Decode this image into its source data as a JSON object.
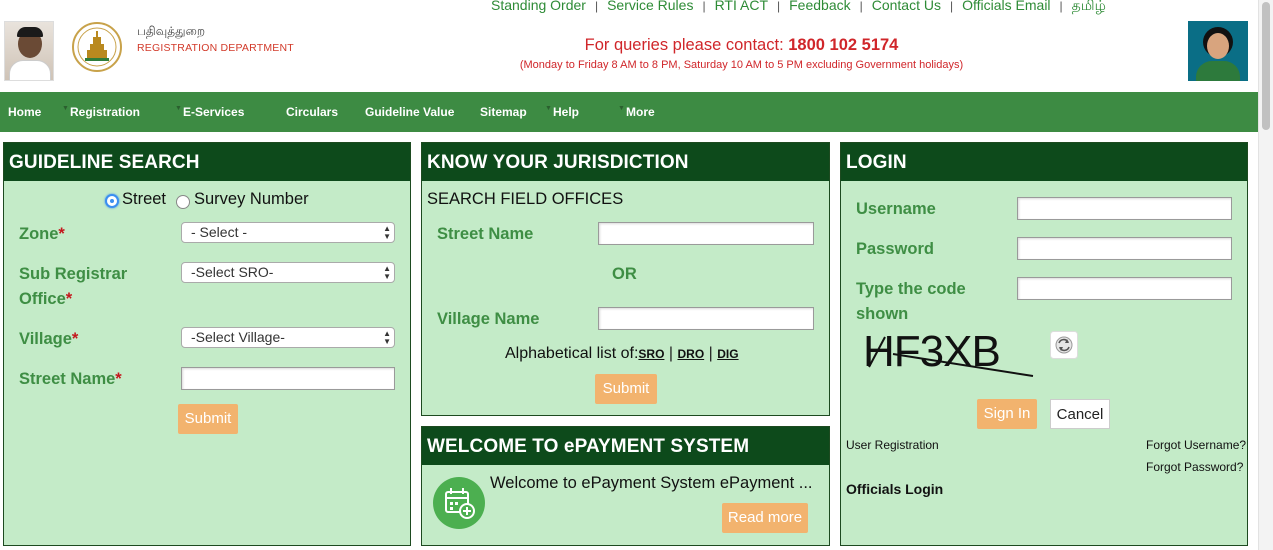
{
  "header": {
    "dept_tamil": "பதிவுத்துறை",
    "dept_name": "REGISTRATION DEPARTMENT",
    "top_links": [
      "Standing Order",
      "Service Rules",
      "RTI ACT",
      "Feedback",
      "Contact Us",
      "Officials Email",
      "தமிழ்"
    ],
    "contact_prefix": "For queries please contact:",
    "contact_number": "1800 102 5174",
    "contact_hours": "(Monday to Friday 8 AM to 8 PM, Saturday 10 AM to 5 PM excluding Government holidays)"
  },
  "nav": {
    "items": [
      "Home",
      "Registration",
      "E-Services",
      "Circulars",
      "Guideline Value",
      "Sitemap",
      "Help",
      "More"
    ]
  },
  "guideline": {
    "title": "GUIDELINE SEARCH",
    "radio_street": "Street",
    "radio_survey": "Survey Number",
    "zone_label": "Zone",
    "zone_value": "- Select -",
    "sro_label_1": "Sub Registrar",
    "sro_label_2": "Office",
    "sro_value": "-Select SRO-",
    "village_label": "Village",
    "village_value": "-Select Village-",
    "street_label": "Street Name",
    "required_mark": "*",
    "submit": "Submit"
  },
  "jurisdiction": {
    "title": "KNOW YOUR JURISDICTION",
    "subtitle": "SEARCH FIELD OFFICES",
    "street_label": "Street Name",
    "or_text": "OR",
    "village_label": "Village Name",
    "alpha_prefix": "Alphabetical list of:",
    "link_sro": "SRO",
    "link_dro": "DRO",
    "link_dig": "DIG",
    "divider": "|",
    "submit": "Submit"
  },
  "epayment": {
    "title": "WELCOME TO ePAYMENT SYSTEM",
    "text": "Welcome to ePayment System ePayment ...",
    "read_more": "Read more"
  },
  "login": {
    "title": "LOGIN",
    "username_label": "Username",
    "password_label": "Password",
    "code_label_1": "Type the code",
    "code_label_2": "shown",
    "captcha": "HF3XB",
    "sign_in": "Sign In",
    "cancel": "Cancel",
    "user_registration": "User Registration",
    "forgot_username": "Forgot Username?",
    "forgot_password": "Forgot Password?",
    "officials_login": "Officials Login"
  }
}
